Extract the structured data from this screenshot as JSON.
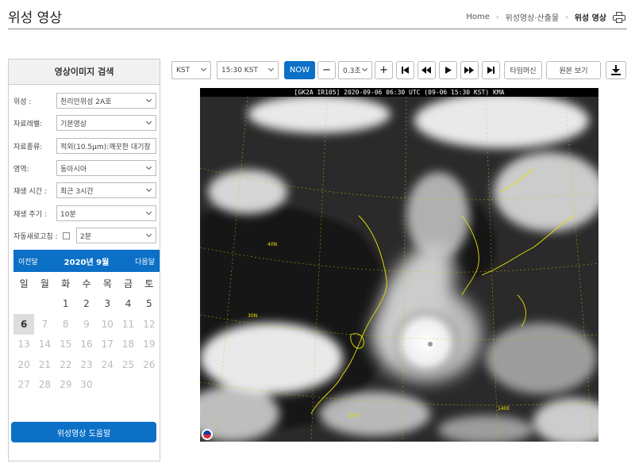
{
  "header": {
    "title": "위성 영상",
    "breadcrumb": [
      "Home",
      "위성영상·산출물",
      "위성 영상"
    ],
    "separator": "›"
  },
  "sidebar": {
    "heading": "영상이미지 검색",
    "fields": [
      {
        "label": "위성 :",
        "value": "천리안위성 2A호"
      },
      {
        "label": "자료레벨:",
        "value": "기본영상"
      },
      {
        "label": "자료종류:",
        "value": "적외(10.5μm):깨끗한 대기창"
      },
      {
        "label": "영역:",
        "value": "동아시아"
      },
      {
        "label": "재생 시간 :",
        "value": "최근 3시간"
      },
      {
        "label": "재생 주기 :",
        "value": "10분"
      },
      {
        "label": "자동새로고침 :",
        "value": "2분",
        "checkbox": false
      }
    ],
    "calendar": {
      "prev_label": "이전달",
      "next_label": "다음달",
      "month_label": "2020년 9월",
      "weekdays": [
        "일",
        "월",
        "화",
        "수",
        "목",
        "금",
        "토"
      ],
      "days_row1": [
        "",
        "",
        "1",
        "2",
        "3",
        "4",
        "5"
      ],
      "days_row2": [
        "6",
        "7",
        "8",
        "9",
        "10",
        "11",
        "12"
      ],
      "days_row3": [
        "13",
        "14",
        "15",
        "16",
        "17",
        "18",
        "19"
      ],
      "days_row4": [
        "20",
        "21",
        "22",
        "23",
        "24",
        "25",
        "26"
      ],
      "days_row5": [
        "27",
        "28",
        "29",
        "30",
        "",
        "",
        ""
      ],
      "selected_day": "6"
    },
    "help_button": "위성영상   도움말"
  },
  "toolbar": {
    "timezone": "KST",
    "time": "15:30 KST",
    "now": "NOW",
    "speed": "0.3초",
    "timemachine": "타임머신",
    "original": "원본 보기"
  },
  "satellite": {
    "caption": "[GK2A IR105] 2020-09-06 06:30 UTC (09-06 15:30 KST) KMA"
  }
}
